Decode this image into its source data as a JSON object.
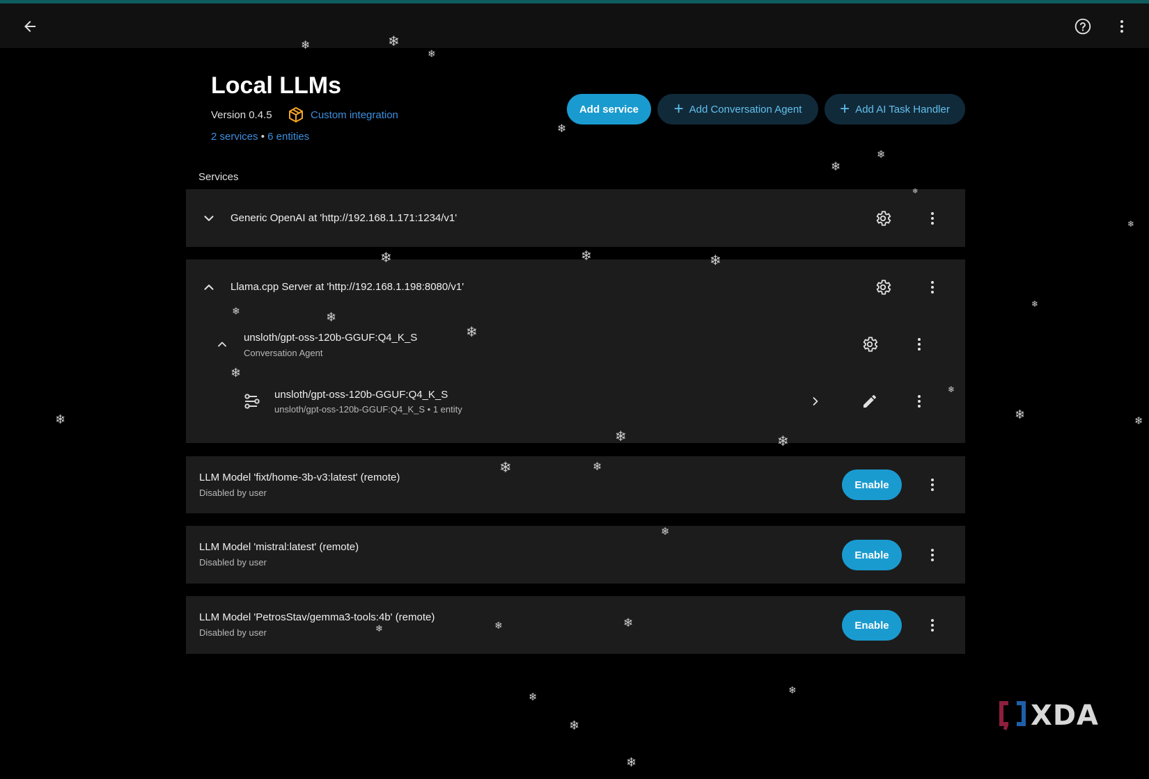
{
  "appbar": {
    "back_icon": "arrow-left-icon",
    "help_icon": "help-circle-icon",
    "more_icon": "dots-vertical-icon"
  },
  "header": {
    "title": "Local LLMs",
    "version": "Version 0.4.5",
    "custom_integration_icon": "package-icon",
    "custom_integration_label": "Custom integration",
    "services_link": "2 services",
    "separator": "•",
    "entities_link": "6 entities"
  },
  "actions": {
    "add_service": "Add service",
    "add_conversation_agent": "Add Conversation Agent",
    "add_ai_task_handler": "Add AI Task Handler"
  },
  "services_label": "Services",
  "services": [
    {
      "title": "Generic OpenAI at 'http://192.168.1.171:1234/v1'",
      "expanded": false
    },
    {
      "title": "Llama.cpp Server at 'http://192.168.1.198:8080/v1'",
      "expanded": true,
      "subentry": {
        "title": "unsloth/gpt-oss-120b-GGUF:Q4_K_S",
        "subtitle": "Conversation Agent",
        "device": {
          "title": "unsloth/gpt-oss-120b-GGUF:Q4_K_S",
          "subtitle": "unsloth/gpt-oss-120b-GGUF:Q4_K_S • 1 entity"
        }
      }
    }
  ],
  "disabled_entries": [
    {
      "title": "LLM Model 'fixt/home-3b-v3:latest' (remote)",
      "subtitle": "Disabled by user",
      "button": "Enable"
    },
    {
      "title": "LLM Model 'mistral:latest' (remote)",
      "subtitle": "Disabled by user",
      "button": "Enable"
    },
    {
      "title": "LLM Model 'PetrosStav/gemma3-tools:4b' (remote)",
      "subtitle": "Disabled by user",
      "button": "Enable"
    }
  ],
  "watermark": "XDA",
  "colors": {
    "accent": "#1a9bd0",
    "link": "#3d8fe0",
    "card": "#1c1c1c",
    "tonal_button": "#112a3a",
    "integration_icon": "#f5a623"
  }
}
